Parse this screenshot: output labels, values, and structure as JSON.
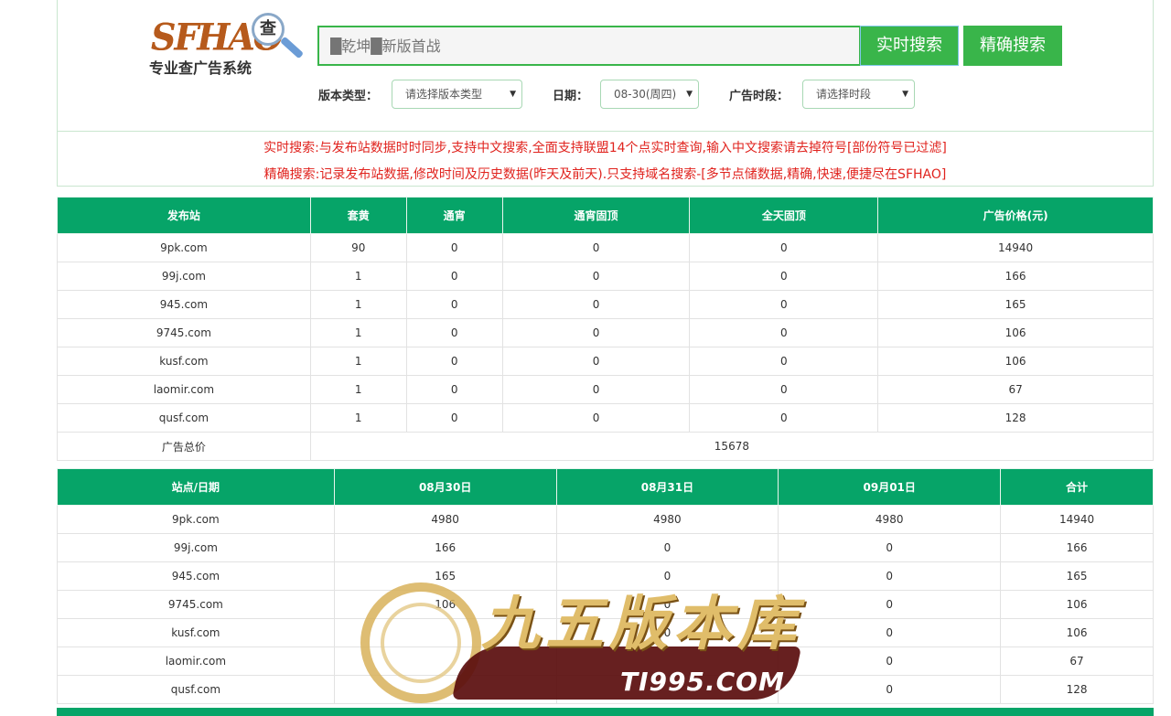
{
  "logo": {
    "brand": "SFHAO",
    "magnifier_char": "查",
    "tagline": "专业查广告系统"
  },
  "search": {
    "placeholder": "█乾坤█新版首战",
    "realtime_label": "实时搜索",
    "exact_label": "精确搜索"
  },
  "filters": {
    "version_label": "版本类型：",
    "version_value": "请选择版本类型",
    "date_label": "日期：",
    "date_value": "08-30(周四)",
    "period_label": "广告时段：",
    "period_value": "请选择时段"
  },
  "notice": {
    "line1": "实时搜索:与发布站数据时时同步,支持中文搜索,全面支持联盟14个点实时查询,输入中文搜索请去掉符号[部份符号已过滤]",
    "line2": "精确搜索:记录发布站数据,修改时间及历史数据(昨天及前天).只支持域名搜索-[多节点储数据,精确,快速,便捷尽在SFHAO]"
  },
  "ads_table": {
    "headers": [
      "发布站",
      "套黄",
      "通宵",
      "通宵固顶",
      "全天固顶",
      "广告价格(元)"
    ],
    "rows": [
      [
        "9pk.com",
        "90",
        "0",
        "0",
        "0",
        "14940"
      ],
      [
        "99j.com",
        "1",
        "0",
        "0",
        "0",
        "166"
      ],
      [
        "945.com",
        "1",
        "0",
        "0",
        "0",
        "165"
      ],
      [
        "9745.com",
        "1",
        "0",
        "0",
        "0",
        "106"
      ],
      [
        "kusf.com",
        "1",
        "0",
        "0",
        "0",
        "106"
      ],
      [
        "laomir.com",
        "1",
        "0",
        "0",
        "0",
        "67"
      ],
      [
        "qusf.com",
        "1",
        "0",
        "0",
        "0",
        "128"
      ]
    ],
    "total_label": "广告总价",
    "total_value": "15678"
  },
  "date_table": {
    "headers": [
      "站点/日期",
      "08月30日",
      "08月31日",
      "09月01日",
      "合计"
    ],
    "rows": [
      [
        "9pk.com",
        "4980",
        "4980",
        "4980",
        "14940"
      ],
      [
        "99j.com",
        "166",
        "0",
        "0",
        "166"
      ],
      [
        "945.com",
        "165",
        "0",
        "0",
        "165"
      ],
      [
        "9745.com",
        "106",
        "0",
        "0",
        "106"
      ],
      [
        "kusf.com",
        "",
        "0",
        "0",
        "106"
      ],
      [
        "laomir.com",
        "",
        "",
        "0",
        "67"
      ],
      [
        "qusf.com",
        "",
        "",
        "0",
        "128"
      ]
    ]
  },
  "watermark": {
    "title": "九五版本库",
    "site": "TI995.COM"
  },
  "colors": {
    "green_header": "#06a468",
    "button_green": "#39b54a",
    "notice_red": "#e0231e"
  }
}
